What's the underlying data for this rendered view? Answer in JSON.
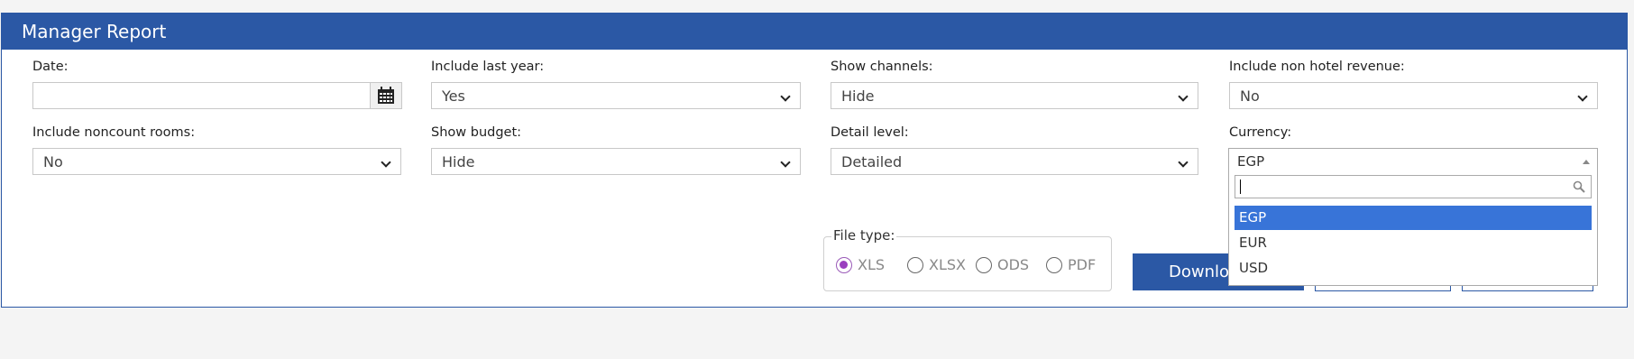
{
  "header": {
    "title": "Manager Report"
  },
  "filters": {
    "date": {
      "label": "Date:",
      "value": ""
    },
    "include_last_year": {
      "label": "Include last year:",
      "value": "Yes"
    },
    "show_channels": {
      "label": "Show channels:",
      "value": "Hide"
    },
    "include_non_hotel_revenue": {
      "label": "Include non hotel revenue:",
      "value": "No"
    },
    "include_noncount_rooms": {
      "label": "Include noncount rooms:",
      "value": "No"
    },
    "show_budget": {
      "label": "Show budget:",
      "value": "Hide"
    },
    "detail_level": {
      "label": "Detail level:",
      "value": "Detailed"
    },
    "currency": {
      "label": "Currency:",
      "value": "EGP",
      "search_value": "",
      "options": [
        "EGP",
        "EUR",
        "USD"
      ],
      "selected_option": "EGP"
    }
  },
  "file_type": {
    "legend": "File type:",
    "options": [
      "XLS",
      "XLSX",
      "ODS",
      "PDF"
    ],
    "selected": "XLS",
    "accent_color": "#9a3fbf"
  },
  "actions": {
    "download_label": "Download"
  },
  "colors": {
    "brand": "#2b58a5",
    "highlight": "#3874d8"
  },
  "icons": {
    "calendar": "calendar-icon",
    "search": "search-icon",
    "chevron": "chevron-down-icon"
  }
}
